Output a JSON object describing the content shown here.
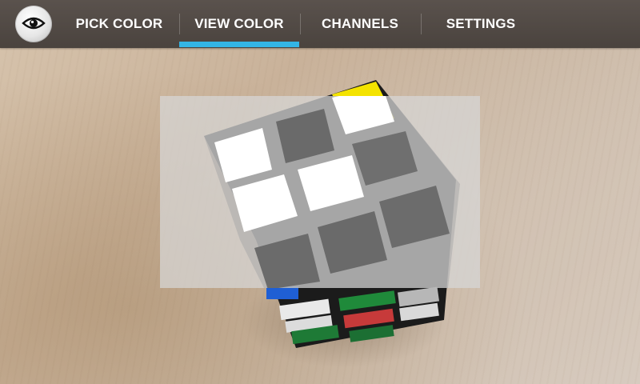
{
  "app": {
    "icon_name": "eye-icon"
  },
  "tabs": [
    {
      "label": "PICK COLOR",
      "selected": false
    },
    {
      "label": "VIEW COLOR",
      "selected": true
    },
    {
      "label": "CHANNELS",
      "selected": false
    },
    {
      "label": "SETTINGS",
      "selected": false
    }
  ],
  "colors": {
    "actionbar": "#4f4843",
    "tab_indicator": "#33b5e5",
    "overlay": "#d7d7d7"
  }
}
